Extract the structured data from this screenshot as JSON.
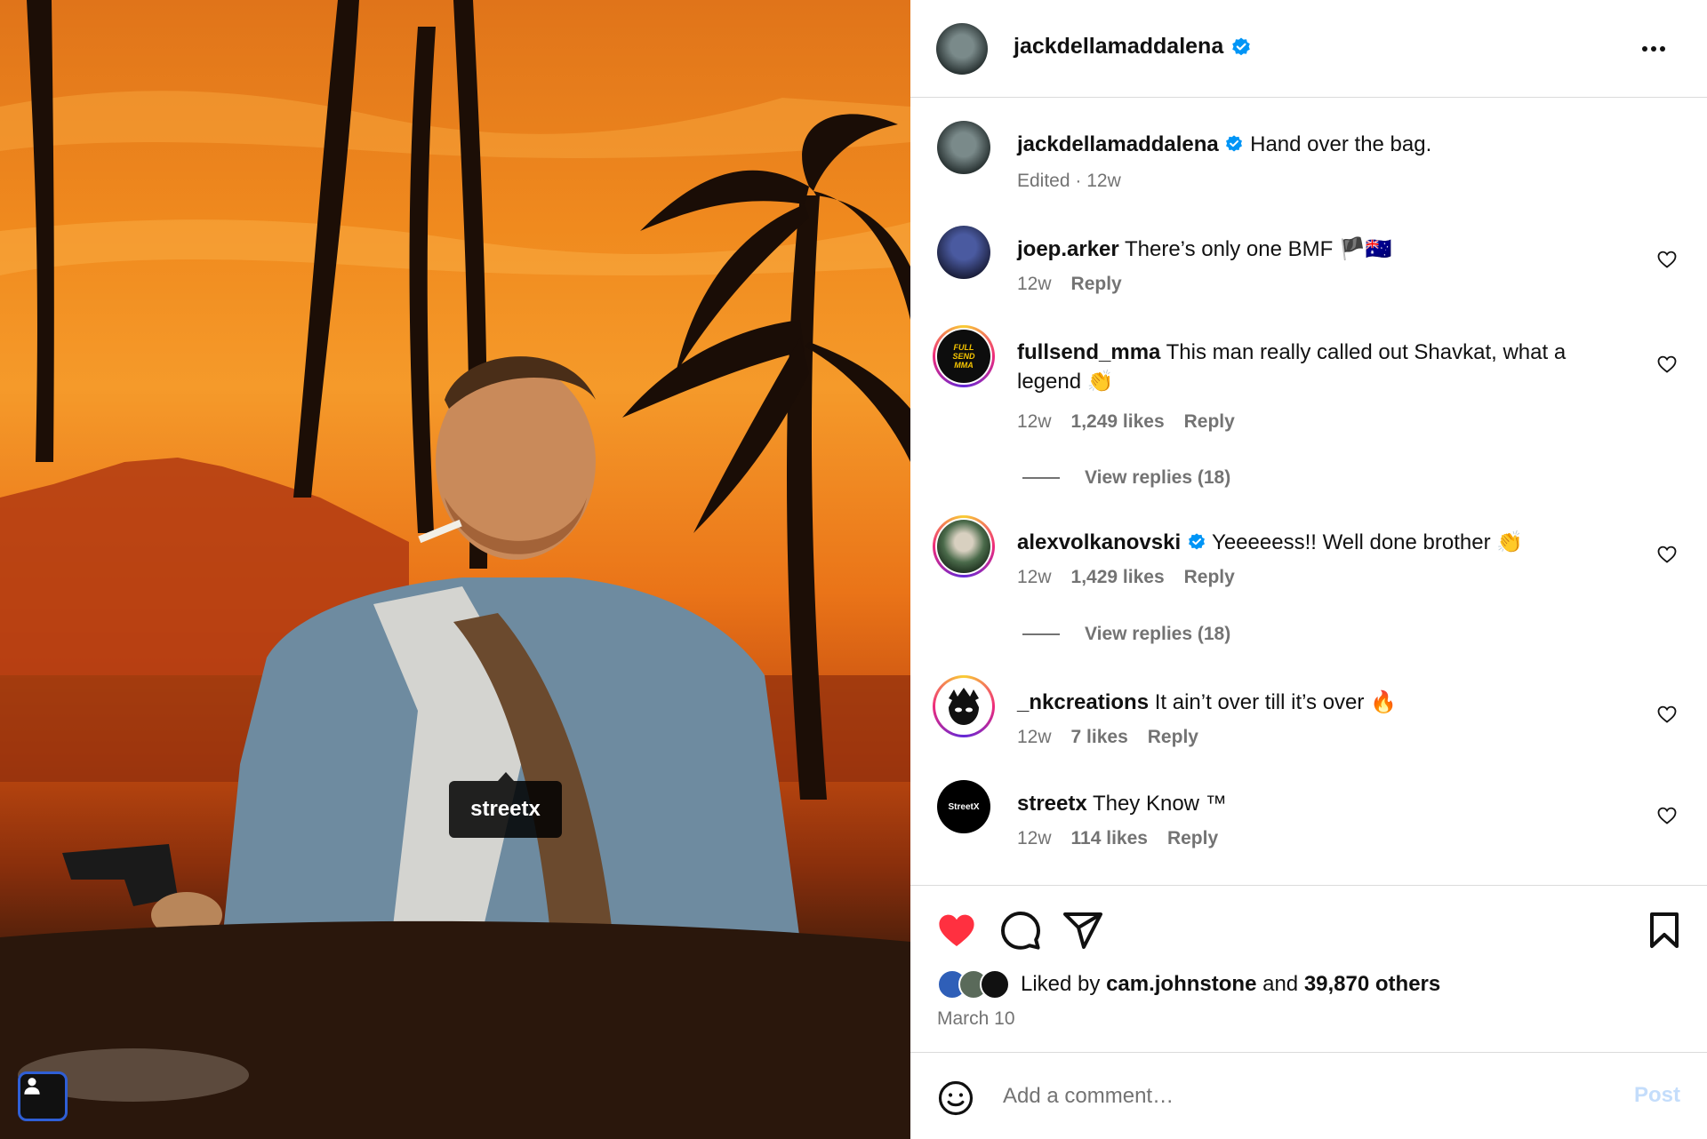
{
  "media": {
    "tag_label": "streetx"
  },
  "post": {
    "author": "jackdellamaddalena",
    "caption": "Hand over the bag.",
    "caption_meta": "Edited · 12w"
  },
  "comments": [
    {
      "user": "joep.arker",
      "text": "There’s only one BMF 🏴🇦🇺",
      "age": "12w",
      "likes": "",
      "reply": "Reply"
    },
    {
      "user": "fullsend_mma",
      "text": "This man really called out Shavkat, what a legend 👏",
      "age": "12w",
      "likes": "1,249 likes",
      "reply": "Reply",
      "view_replies": "View replies (18)"
    },
    {
      "user": "alexvolkanovski",
      "text": "Yeeeeess!! Well done brother 👏",
      "age": "12w",
      "likes": "1,429 likes",
      "reply": "Reply",
      "view_replies": "View replies (18)"
    },
    {
      "user": "_nkcreations",
      "text": "It ain’t over till it’s over 🔥",
      "age": "12w",
      "likes": "7 likes",
      "reply": "Reply"
    },
    {
      "user": "streetx",
      "text": "They Know ™",
      "age": "12w",
      "likes": "114 likes",
      "reply": "Reply"
    }
  ],
  "likes": {
    "prefix": "Liked by",
    "user": "cam.johnstone",
    "and": "and",
    "others": "39,870 others"
  },
  "date": "March 10",
  "comment_box": {
    "placeholder": "Add a comment…",
    "post_label": "Post"
  },
  "avatars": {
    "streetx_label": "StreetX",
    "fullsend_label": "FULL SEND MMA"
  },
  "colors": {
    "liked_heart": "#ff3040",
    "verified": "#0095f6",
    "post_disabled": "#c4ddfb",
    "muted_text": "#737373"
  }
}
